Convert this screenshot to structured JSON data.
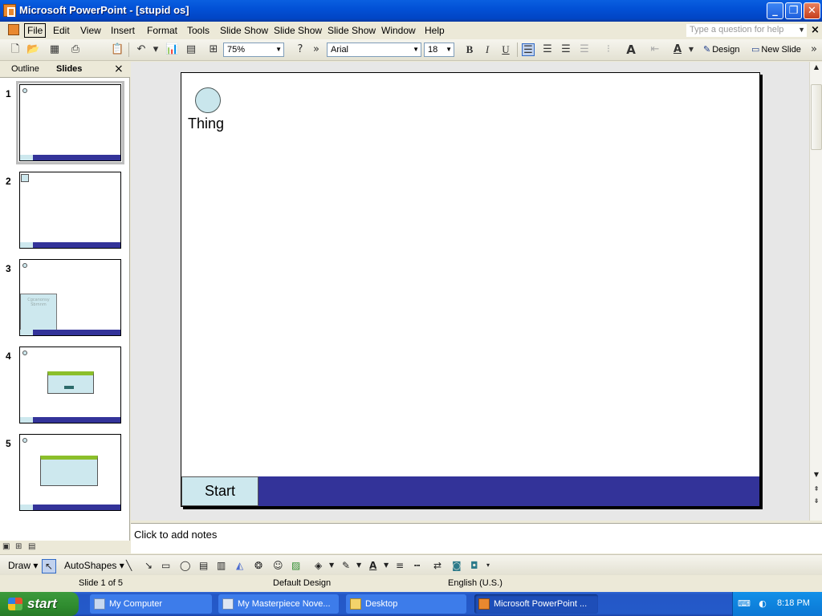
{
  "window": {
    "title": "Microsoft PowerPoint - [stupid os]"
  },
  "menubar": {
    "items": [
      "File",
      "Edit",
      "View",
      "Insert",
      "Format",
      "Tools",
      "Slide Show",
      "Slide Show",
      "Slide Show",
      "Window",
      "Help"
    ],
    "help_placeholder": "Type a question for help"
  },
  "toolbar": {
    "zoom": "75%",
    "font": "Arial",
    "font_size": "18",
    "design_label": "Design",
    "new_slide_label": "New Slide"
  },
  "leftpane": {
    "tab_outline": "Outline",
    "tab_slides": "Slides",
    "slide_numbers": [
      "1",
      "2",
      "3",
      "4",
      "5"
    ],
    "thumb3_text": "Cgcanonsy Sbrnnm"
  },
  "slide": {
    "shape_label": "Thing",
    "start_label": "Start",
    "colors": {
      "footer": "#333399",
      "shape_fill": "#c9e6ec"
    }
  },
  "notes": {
    "placeholder": "Click to add notes"
  },
  "drawbar": {
    "draw_label": "Draw",
    "autoshapes_label": "AutoShapes"
  },
  "status": {
    "slide_of": "Slide 1 of 5",
    "design": "Default Design",
    "language": "English (U.S.)"
  },
  "taskbar": {
    "start_label": "start",
    "tasks": [
      "My Computer",
      "My Masterpiece Nove...",
      "Desktop",
      "Microsoft PowerPoint ..."
    ],
    "clock": "8:18 PM"
  }
}
